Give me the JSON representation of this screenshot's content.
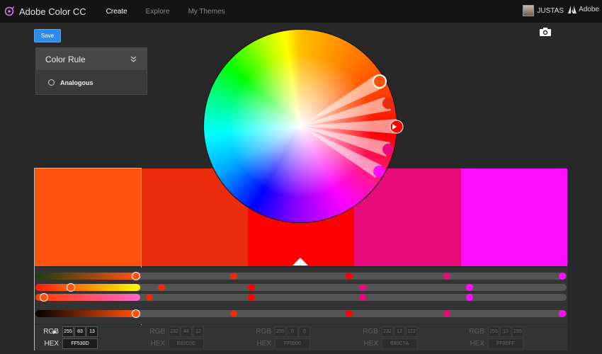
{
  "header": {
    "app_title": "Adobe Color CC",
    "nav": [
      {
        "label": "Create",
        "active": true
      },
      {
        "label": "Explore",
        "active": false
      },
      {
        "label": "My Themes",
        "active": false
      }
    ],
    "user_name": "JUSTAS",
    "brand": "Adobe"
  },
  "toolbar": {
    "save_label": "Save"
  },
  "color_rule": {
    "title": "Color Rule",
    "selected": "Analogous"
  },
  "swatches": [
    {
      "hex": "FF530D",
      "rgb": [
        255,
        83,
        13
      ],
      "active": true
    },
    {
      "hex": "E82C0C",
      "rgb": [
        232,
        44,
        12
      ],
      "active": false
    },
    {
      "hex": "FF0000",
      "rgb": [
        255,
        0,
        0
      ],
      "active": false
    },
    {
      "hex": "E80C7A",
      "rgb": [
        232,
        12,
        122
      ],
      "active": false
    },
    {
      "hex": "FF0DFF",
      "rgb": [
        255,
        13,
        255
      ],
      "active": false
    }
  ],
  "labels": {
    "rgb": "RGB",
    "hex": "HEX"
  },
  "colors": {
    "topbar": "#141414",
    "background": "#282828",
    "accent": "#2d8ceb"
  }
}
